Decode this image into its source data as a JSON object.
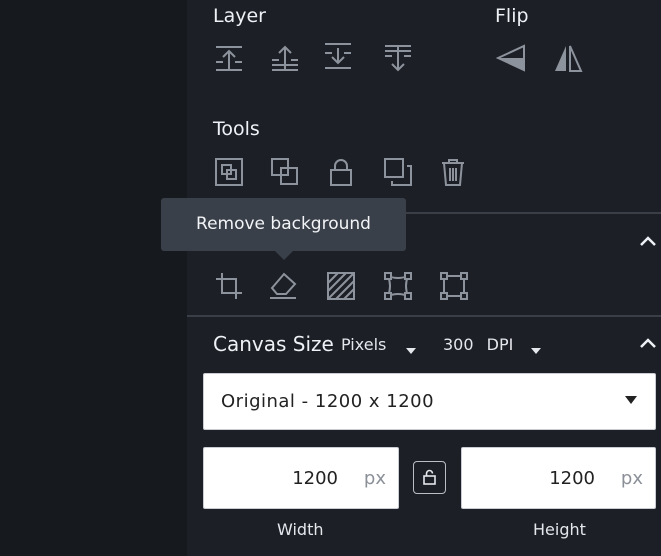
{
  "sections": {
    "layer": {
      "title": "Layer"
    },
    "flip": {
      "title": "Flip"
    },
    "tools": {
      "title": "Tools"
    },
    "canvas_size": {
      "title": "Canvas Size",
      "unit": "Pixels",
      "dpi_value": "300",
      "dpi_label": "DPI",
      "preset": "Original - 1200 x 1200",
      "width": {
        "value": "1200",
        "unit": "px",
        "label": "Width"
      },
      "height": {
        "value": "1200",
        "unit": "px",
        "label": "Height"
      }
    }
  },
  "tooltip": {
    "text": "Remove background"
  },
  "icons": {
    "layer": [
      "bring-to-front-icon",
      "bring-forward-icon",
      "send-backward-icon",
      "send-to-back-icon"
    ],
    "flip": [
      "flip-horizontal-icon",
      "flip-vertical-icon"
    ],
    "tools": [
      "group-icon",
      "ungroup-icon",
      "lock-icon",
      "duplicate-icon",
      "delete-icon"
    ],
    "image": [
      "crop-icon",
      "eraser-icon",
      "pattern-icon",
      "warp-icon",
      "transform-icon"
    ]
  },
  "colors": {
    "panel_bg": "#1c1f25",
    "canvas_bg": "#16191e",
    "icon": "#8d939c",
    "tooltip_bg": "#3a4049",
    "text": "#eef1f5"
  }
}
